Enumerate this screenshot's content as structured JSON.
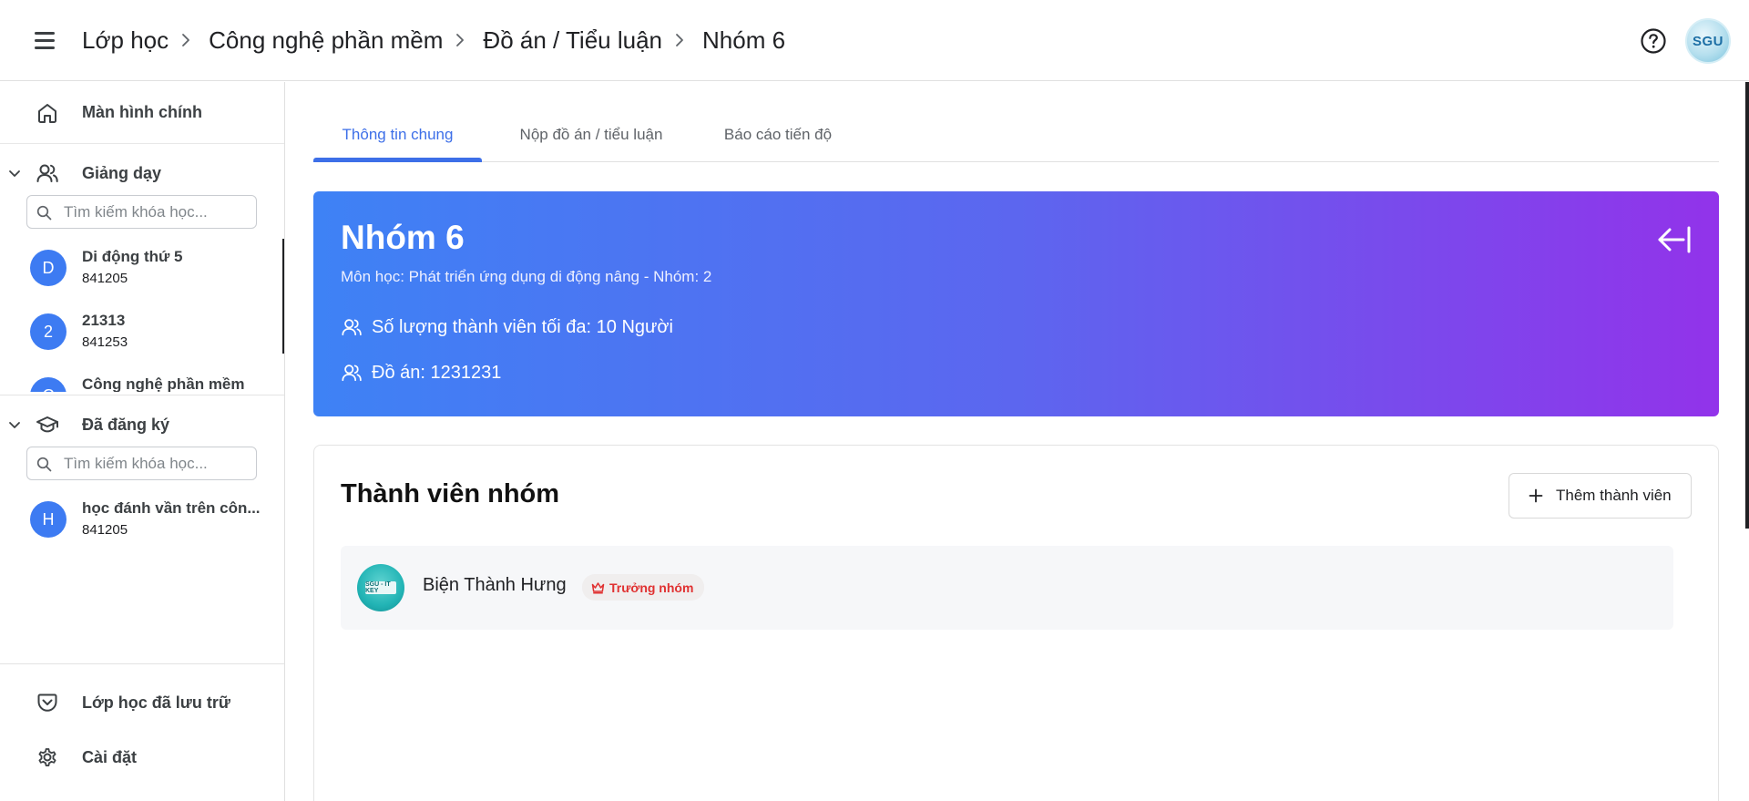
{
  "header": {
    "breadcrumbs": [
      {
        "label": "Lớp học"
      },
      {
        "label": "Công nghệ phần mềm"
      },
      {
        "label": "Đồ án / Tiểu luận"
      },
      {
        "label": "Nhóm 6"
      }
    ],
    "avatar_text": "SGU"
  },
  "sidebar": {
    "home_label": "Màn hình chính",
    "teaching": {
      "label": "Giảng dạy",
      "search_placeholder": "Tìm kiếm khóa học...",
      "courses": [
        {
          "initial": "D",
          "name": "Di động thứ 5",
          "code": "841205"
        },
        {
          "initial": "2",
          "name": "21313",
          "code": "841253"
        },
        {
          "initial": "C",
          "name": "Công nghệ phần mềm",
          "code": ""
        }
      ]
    },
    "enrolled": {
      "label": "Đã đăng ký",
      "search_placeholder": "Tìm kiếm khóa học...",
      "courses": [
        {
          "initial": "H",
          "name": "học đánh vần trên côn...",
          "code": "841205"
        }
      ]
    },
    "archived_label": "Lớp học đã lưu trữ",
    "settings_label": "Cài đặt"
  },
  "tabs": [
    {
      "label": "Thông tin chung",
      "active": true
    },
    {
      "label": "Nộp đồ án / tiểu luận",
      "active": false
    },
    {
      "label": "Báo cáo tiến độ",
      "active": false
    }
  ],
  "group": {
    "title": "Nhóm 6",
    "subtitle": "Môn học: Phát triển ứng dụng di động nâng - Nhóm: 2",
    "max_members": "Số lượng thành viên tối đa: 10 Người",
    "project": "Đồ án: 1231231"
  },
  "members": {
    "title": "Thành viên nhóm",
    "add_label": "Thêm thành viên",
    "list": [
      {
        "name": "Biện Thành Hưng",
        "role": "Trưởng nhóm",
        "avatar_text": "SGU - IT KEY"
      }
    ]
  },
  "colors": {
    "accent": "#3d6fe8",
    "banner_start": "#3e82f5",
    "banner_end": "#9233ea",
    "leader_red": "#e03131"
  }
}
